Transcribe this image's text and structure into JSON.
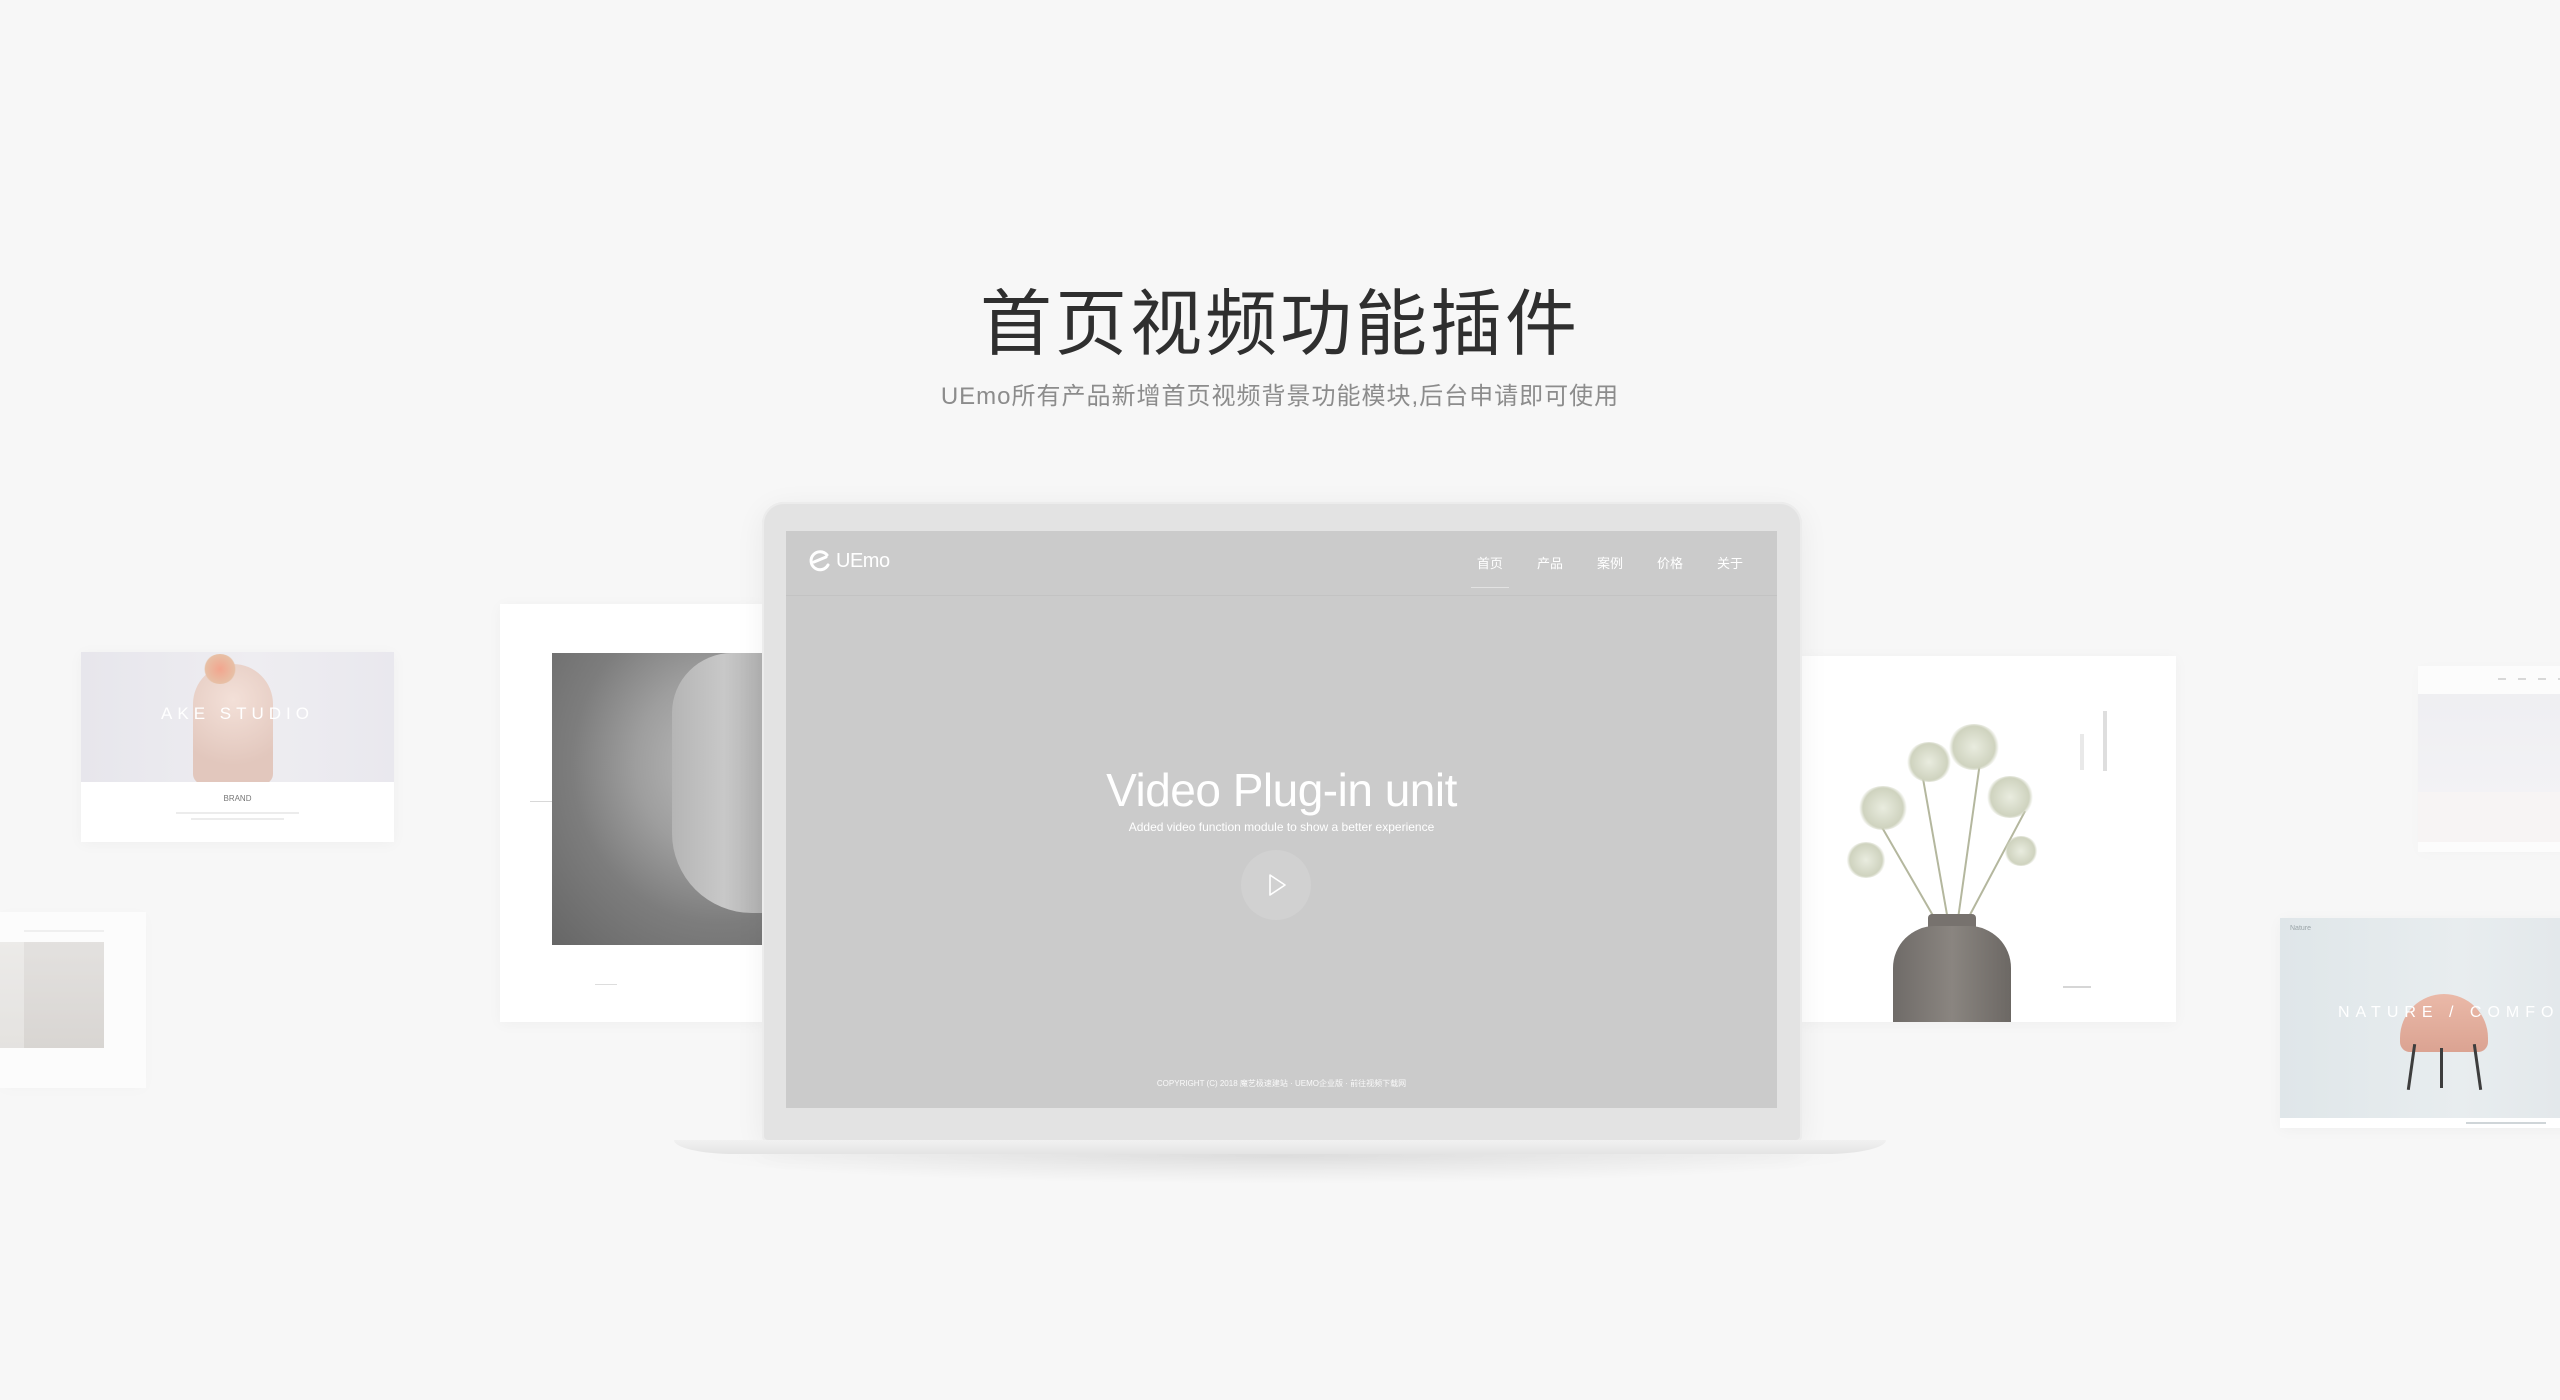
{
  "hero": {
    "title": "首页视频功能插件",
    "subtitle": "UEmo所有产品新增首页视频背景功能模块,后台申请即可使用"
  },
  "laptop_screen": {
    "logo_text": "UEmo",
    "nav": [
      {
        "label": "首页",
        "active": true
      },
      {
        "label": "产品",
        "active": false
      },
      {
        "label": "案例",
        "active": false
      },
      {
        "label": "价格",
        "active": false
      },
      {
        "label": "关于",
        "active": false
      }
    ],
    "title": "Video Plug-in unit",
    "subtitle": "Added video function module to show a better experience",
    "play_icon": "play-icon",
    "footer": "COPYRIGHT (C) 2018 魔艺极速建站 · UEMO企业版 · 前往视频下载网",
    "background": "#cbcbcb"
  },
  "cards": {
    "studio": {
      "brand": "AKE STUDIO",
      "tag": "BRAND"
    },
    "nature": {
      "title": "NATURE / COMFORT",
      "logo": "Nature"
    }
  },
  "colors": {
    "page_background": "#f7f7f7",
    "headline": "#2f2f2f",
    "subline": "#8c8c8c"
  }
}
